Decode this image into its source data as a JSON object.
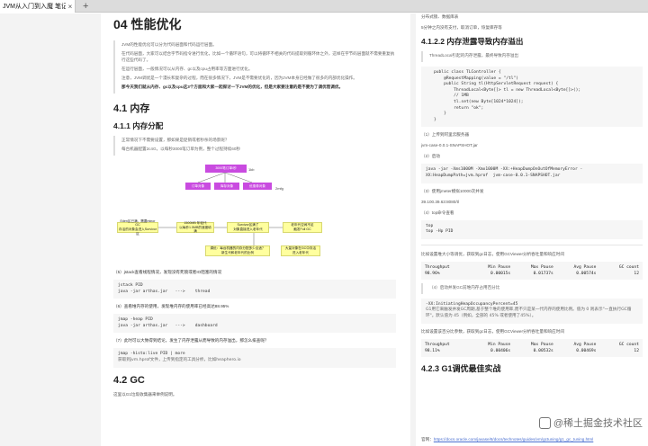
{
  "tab": {
    "title": "JVM从入门到入魔 笔记",
    "close": "×",
    "add": "+"
  },
  "left": {
    "h1": "04 性能优化",
    "intro": [
      "JVM的性能优化可以分为代码层面和代码运行层面。",
      "在代码层面，大家可以结合字节码指令进行优化，比如一个循环语句，可以将循环不相关的代码提取到循环体之外，这样在字节码层面就不需要重复执行这些代码了。",
      "在运行层面，一般情况可以从内存、gc以及cpu占用率等方面进行优化。",
      "注意，JVM调优是一个漫长和复杂的过程，而在很多情况下，JVM是不需要优化的，因为JVM本身已经做了很多的内部优化操作。",
      "那今天我们就从内存、gc以及cpu这3个方面和大家一起探讨一下JVM的优化，但是大家要注意的是不要为了调优而调优。"
    ],
    "h2_memory": "4.1 内存",
    "h3_alloc": "4.1.1 内存分配",
    "alloc_quote": [
      "正常情况下不需要设置，那如果是促销或者秒杀的场景呢？",
      "每台机器配置2c4G，以每秒3000笔订单为例，整个过程持续60秒"
    ],
    "diagram": {
      "top": "3000笔订单/秒",
      "m1": "订单对象",
      "m2": "库存对象",
      "m3": "优惠券对象",
      "size": "1kb",
      "size2": "2mfg",
      "r1": "Eden区已满，需要minor GC\n存活的对象会进入Survivor区",
      "r2": "1500MB 年轻代\n以每秒1.5MB的速度填满",
      "r3": "Survivor区满了\n对象直接进入老年代",
      "r4": "老年代空间不足\n触发Full GC",
      "r5": "调优：每台机器的内存分配多少合适？\n新生代和老年代的比例",
      "r6": "大量对象在GC中存活\n进入老年代"
    },
    "jstack_text": "（5）jstack查看线程情况，发现没有死锁或者IO阻塞的情况",
    "jstack_code": [
      "jstack PID",
      "java -jar arthas.jar   --->    thread"
    ],
    "jmap_text": "（6）查看堆内存的使用，发现堆内存的使用率已经高达88.95%",
    "jmap_code": [
      "jmap -heap PID",
      "java -jar arthas.jar   --->    dashboard"
    ],
    "leak_text": "（7）此时可以大致得到结论，发生了内存泄露从而导致的内存溢出，那怎么排查呢？",
    "histo_code": "jmap -histo:live PID | more",
    "histo_comment": "获取到jvm.hprof文件，上传到指定的工具分析，比如heaphero.io",
    "h2_gc": "4.2 GC",
    "gc_text": "这里以G1垃圾收集器来举例说明。"
  },
  "right": {
    "top_lines": [
      "分布式锁、数据库表",
      "5分钟之内没有支付，取消订单，恢复库存等"
    ],
    "h3_oom": "4.1.2.2 内存泄露导致内存溢出",
    "oom_quote": "ThreadLocal引起的内存泄露，最终导致内存溢出",
    "java_code": [
      "public class TLController {",
      "    @RequestMapping(value = \"/tl\")",
      "    public String tl(HttpServletRequest request) {",
      "        ThreadLocal<Byte[]> tl = new ThreadLocal<Byte[]>();",
      "        // 1MB",
      "        tl.set(new Byte[1024*1024]);",
      "        return \"ok\";",
      "    }",
      "}"
    ],
    "step1": "（1）上传到阿里云服务器",
    "jar": "jvm-case-0.0.1-SNAPSHOT.jar",
    "step2": "（2）启动",
    "start_code": [
      "java -jar -Xms1000M -Xmx1000M -XX:+HeapDumpOnOutOfMemoryError -",
      "XX:HeapDumpPath=jvm.hprof  jvm-case-0.0.1-SNAPSHOT.jar"
    ],
    "step3": "（3）使用jmeter模拟10000次并发",
    "url": "39.100.39.63:8080/tl",
    "step4": "（4）top命令查看",
    "top_code": [
      "top",
      "top -Hp PID"
    ],
    "gc1_text": "比如设置堆大小等调优，获取到gc日志，使用GCViewer分析吞吐量和响应时间",
    "table_headers": [
      "Throughput",
      "Min Pause",
      "Max Pause",
      "Avg Pause",
      "GC count"
    ],
    "table1": [
      "98.96%",
      "0.00015s",
      "0.01737s",
      "0.00574s",
      "12"
    ],
    "step_g1": "（4）启动并发GC前堆内存占用百分比",
    "g1_code": "-XX:InitiatingHeapOccupancyPercent=45",
    "g1_comment": "G1用它来触发并发GC周期,基于整个堆的使用率,而不只是某一代内存的使用比例。值为 0 则表示\"一直执行GC循环\"。默认值为 45（例如，全部的 45% 或者使用了45%）。",
    "gc2_text": "比如设置该百分比参数，获取到gc日志，使用GCViewer分析吞吐量和响应时间",
    "table2": [
      "98.11%",
      "0.00406s",
      "0.00532s",
      "0.00469s",
      "12"
    ],
    "h3_g1": "4.2.3 G1调优最佳实战",
    "ref_label": "官网：",
    "ref_url": "https://docs.oracle.com/javase/8/docs/technotes/guides/vm/gctuning/g1_gc_tuning.html"
  },
  "watermark": "@稀土掘金技术社区"
}
